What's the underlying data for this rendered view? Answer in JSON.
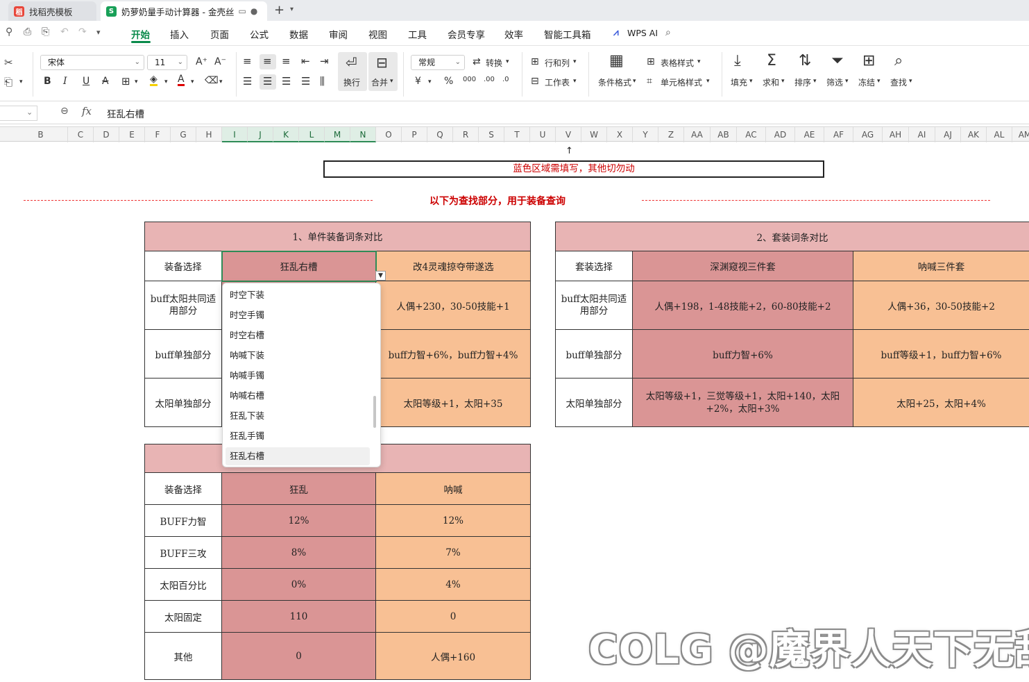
{
  "tabs": [
    {
      "label": "找稻壳模板",
      "icon": "docer-icon"
    },
    {
      "label": "奶萝奶量手动计算器 - 金壳丝",
      "icon": "spreadsheet-icon"
    }
  ],
  "menu": {
    "items": [
      "开始",
      "插入",
      "页面",
      "公式",
      "数据",
      "审阅",
      "视图",
      "工具",
      "会员专享",
      "效率",
      "智能工具箱"
    ],
    "active": "开始",
    "wps_ai": "WPS AI"
  },
  "ribbon": {
    "font_name": "宋体",
    "font_size": "11",
    "wrap": "换行",
    "merge": "合并",
    "number_format": "常规",
    "convert": "转换",
    "rows_cols": "行和列",
    "worksheet": "工作表",
    "cond_format": "条件格式",
    "table_style": "表格样式",
    "cell_style": "单元格样式",
    "fill": "填充",
    "sum": "求和",
    "sort": "排序",
    "filter": "筛选",
    "freeze": "冻结",
    "find": "查找"
  },
  "formula_bar": {
    "value": "狂乱右槽"
  },
  "columns": [
    "B",
    "C",
    "D",
    "E",
    "F",
    "G",
    "H",
    "I",
    "J",
    "K",
    "L",
    "M",
    "N",
    "O",
    "P",
    "Q",
    "R",
    "S",
    "T",
    "U",
    "V",
    "W",
    "X",
    "Y",
    "Z",
    "AA",
    "AB",
    "AC",
    "AD",
    "AE",
    "AF",
    "AG",
    "AH",
    "AI",
    "AJ",
    "AK",
    "AL",
    "AM"
  ],
  "selected_columns": [
    "I",
    "J",
    "K",
    "L",
    "M",
    "N"
  ],
  "sheet": {
    "notice": "蓝色区域需填写，其他切勿动",
    "section_heading": "以下为查找部分，用于装备查询",
    "table1": {
      "title": "1、单件装备词条对比",
      "rows": [
        {
          "label": "装备选择",
          "a": "狂乱右槽",
          "b": "改4灵魂掠夺带遂选"
        },
        {
          "label": "buff太阳共同适用部分",
          "a": "",
          "b": "人偶+230，30-50技能+1"
        },
        {
          "label": "buff单独部分",
          "a": "",
          "b": "buff力智+6%，buff力智+4%"
        },
        {
          "label": "太阳单独部分",
          "a": "",
          "b": "太阳等级+1，太阳+35"
        }
      ]
    },
    "table2": {
      "title": "2、套装词条对比",
      "rows": [
        {
          "label": "套装选择",
          "a": "深渊窥视三件套",
          "b": "呐喊三件套"
        },
        {
          "label": "buff太阳共同适用部分",
          "a": "人偶+198，1-48技能+2，60-80技能+2",
          "b": "人偶+36，30-50技能+2"
        },
        {
          "label": "buff单独部分",
          "a": "buff力智+6%",
          "b": "buff等级+1，buff力智+6%"
        },
        {
          "label": "太阳单独部分",
          "a": "太阳等级+1，三觉等级+1，太阳+140，太阳+2%，太阳+3%",
          "b": "太阳+25，太阳+4%"
        }
      ]
    },
    "table3": {
      "title": "",
      "rows": [
        {
          "label": "装备选择",
          "a": "狂乱",
          "b": "呐喊"
        },
        {
          "label": "BUFF力智",
          "a": "12%",
          "b": "12%"
        },
        {
          "label": "BUFF三攻",
          "a": "8%",
          "b": "7%"
        },
        {
          "label": "太阳百分比",
          "a": "0%",
          "b": "4%"
        },
        {
          "label": "太阳固定",
          "a": "110",
          "b": "0"
        },
        {
          "label": "其他",
          "a": "0",
          "b": "人偶+160"
        }
      ]
    }
  },
  "dropdown": {
    "options": [
      "时空下装",
      "时空手镯",
      "时空右槽",
      "呐喊下装",
      "呐喊手镯",
      "呐喊右槽",
      "狂乱下装",
      "狂乱手镯",
      "狂乱右槽"
    ],
    "selected": "狂乱右槽"
  },
  "watermark": "COLG @魔界人天下无敌",
  "colors": {
    "accent": "#0a8a4b",
    "header": "#e8b4b4",
    "col1": "#da9595",
    "col2": "#f8c094",
    "notice": "#cc0000"
  }
}
